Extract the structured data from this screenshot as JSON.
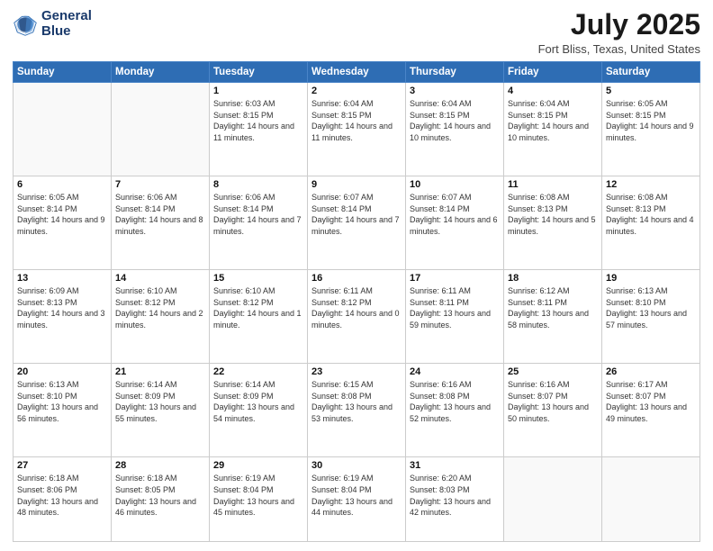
{
  "header": {
    "logo_line1": "General",
    "logo_line2": "Blue",
    "month_title": "July 2025",
    "location": "Fort Bliss, Texas, United States"
  },
  "days_of_week": [
    "Sunday",
    "Monday",
    "Tuesday",
    "Wednesday",
    "Thursday",
    "Friday",
    "Saturday"
  ],
  "weeks": [
    [
      {
        "num": "",
        "info": ""
      },
      {
        "num": "",
        "info": ""
      },
      {
        "num": "1",
        "info": "Sunrise: 6:03 AM\nSunset: 8:15 PM\nDaylight: 14 hours and 11 minutes."
      },
      {
        "num": "2",
        "info": "Sunrise: 6:04 AM\nSunset: 8:15 PM\nDaylight: 14 hours and 11 minutes."
      },
      {
        "num": "3",
        "info": "Sunrise: 6:04 AM\nSunset: 8:15 PM\nDaylight: 14 hours and 10 minutes."
      },
      {
        "num": "4",
        "info": "Sunrise: 6:04 AM\nSunset: 8:15 PM\nDaylight: 14 hours and 10 minutes."
      },
      {
        "num": "5",
        "info": "Sunrise: 6:05 AM\nSunset: 8:15 PM\nDaylight: 14 hours and 9 minutes."
      }
    ],
    [
      {
        "num": "6",
        "info": "Sunrise: 6:05 AM\nSunset: 8:14 PM\nDaylight: 14 hours and 9 minutes."
      },
      {
        "num": "7",
        "info": "Sunrise: 6:06 AM\nSunset: 8:14 PM\nDaylight: 14 hours and 8 minutes."
      },
      {
        "num": "8",
        "info": "Sunrise: 6:06 AM\nSunset: 8:14 PM\nDaylight: 14 hours and 7 minutes."
      },
      {
        "num": "9",
        "info": "Sunrise: 6:07 AM\nSunset: 8:14 PM\nDaylight: 14 hours and 7 minutes."
      },
      {
        "num": "10",
        "info": "Sunrise: 6:07 AM\nSunset: 8:14 PM\nDaylight: 14 hours and 6 minutes."
      },
      {
        "num": "11",
        "info": "Sunrise: 6:08 AM\nSunset: 8:13 PM\nDaylight: 14 hours and 5 minutes."
      },
      {
        "num": "12",
        "info": "Sunrise: 6:08 AM\nSunset: 8:13 PM\nDaylight: 14 hours and 4 minutes."
      }
    ],
    [
      {
        "num": "13",
        "info": "Sunrise: 6:09 AM\nSunset: 8:13 PM\nDaylight: 14 hours and 3 minutes."
      },
      {
        "num": "14",
        "info": "Sunrise: 6:10 AM\nSunset: 8:12 PM\nDaylight: 14 hours and 2 minutes."
      },
      {
        "num": "15",
        "info": "Sunrise: 6:10 AM\nSunset: 8:12 PM\nDaylight: 14 hours and 1 minute."
      },
      {
        "num": "16",
        "info": "Sunrise: 6:11 AM\nSunset: 8:12 PM\nDaylight: 14 hours and 0 minutes."
      },
      {
        "num": "17",
        "info": "Sunrise: 6:11 AM\nSunset: 8:11 PM\nDaylight: 13 hours and 59 minutes."
      },
      {
        "num": "18",
        "info": "Sunrise: 6:12 AM\nSunset: 8:11 PM\nDaylight: 13 hours and 58 minutes."
      },
      {
        "num": "19",
        "info": "Sunrise: 6:13 AM\nSunset: 8:10 PM\nDaylight: 13 hours and 57 minutes."
      }
    ],
    [
      {
        "num": "20",
        "info": "Sunrise: 6:13 AM\nSunset: 8:10 PM\nDaylight: 13 hours and 56 minutes."
      },
      {
        "num": "21",
        "info": "Sunrise: 6:14 AM\nSunset: 8:09 PM\nDaylight: 13 hours and 55 minutes."
      },
      {
        "num": "22",
        "info": "Sunrise: 6:14 AM\nSunset: 8:09 PM\nDaylight: 13 hours and 54 minutes."
      },
      {
        "num": "23",
        "info": "Sunrise: 6:15 AM\nSunset: 8:08 PM\nDaylight: 13 hours and 53 minutes."
      },
      {
        "num": "24",
        "info": "Sunrise: 6:16 AM\nSunset: 8:08 PM\nDaylight: 13 hours and 52 minutes."
      },
      {
        "num": "25",
        "info": "Sunrise: 6:16 AM\nSunset: 8:07 PM\nDaylight: 13 hours and 50 minutes."
      },
      {
        "num": "26",
        "info": "Sunrise: 6:17 AM\nSunset: 8:07 PM\nDaylight: 13 hours and 49 minutes."
      }
    ],
    [
      {
        "num": "27",
        "info": "Sunrise: 6:18 AM\nSunset: 8:06 PM\nDaylight: 13 hours and 48 minutes."
      },
      {
        "num": "28",
        "info": "Sunrise: 6:18 AM\nSunset: 8:05 PM\nDaylight: 13 hours and 46 minutes."
      },
      {
        "num": "29",
        "info": "Sunrise: 6:19 AM\nSunset: 8:04 PM\nDaylight: 13 hours and 45 minutes."
      },
      {
        "num": "30",
        "info": "Sunrise: 6:19 AM\nSunset: 8:04 PM\nDaylight: 13 hours and 44 minutes."
      },
      {
        "num": "31",
        "info": "Sunrise: 6:20 AM\nSunset: 8:03 PM\nDaylight: 13 hours and 42 minutes."
      },
      {
        "num": "",
        "info": ""
      },
      {
        "num": "",
        "info": ""
      }
    ]
  ]
}
